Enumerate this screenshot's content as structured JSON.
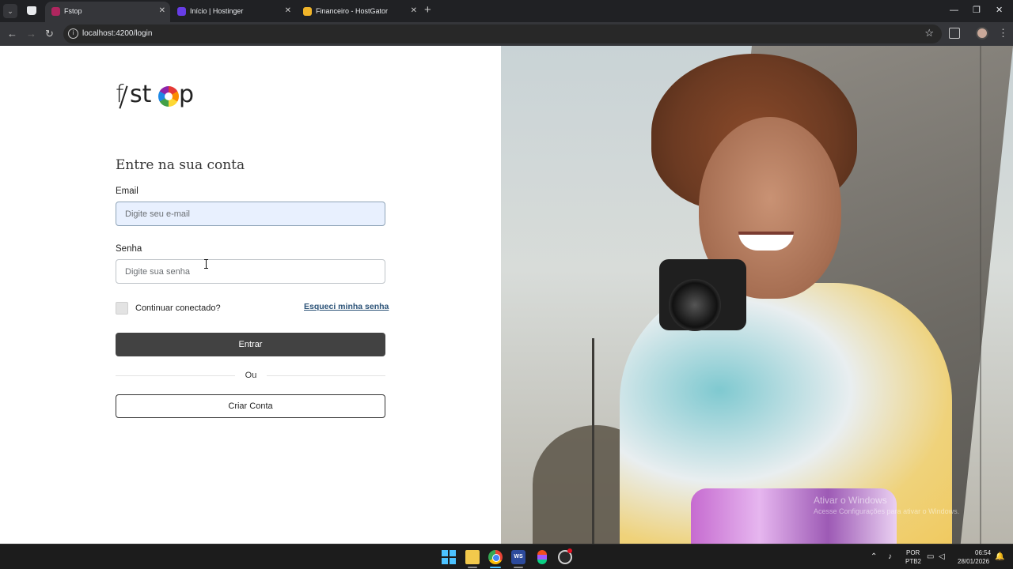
{
  "browser": {
    "tabs": [
      {
        "title": "Fstop",
        "active": true,
        "favicon_color": "#b0265f"
      },
      {
        "title": "Início | Hostinger",
        "active": false,
        "favicon_color": "#673de6"
      },
      {
        "title": "Financeiro - HostGator",
        "active": false,
        "favicon_color": "#f0b429"
      }
    ],
    "url": "localhost:4200/login"
  },
  "page": {
    "logo_text": "f/stop",
    "heading": "Entre na sua conta",
    "email": {
      "label": "Email",
      "placeholder": "Digite seu e-mail",
      "value": ""
    },
    "password": {
      "label": "Senha",
      "placeholder": "Digite sua senha",
      "value": ""
    },
    "remember_label": "Continuar conectado?",
    "remember_checked": false,
    "forgot_link": "Esqueci minha senha",
    "login_button": "Entrar",
    "divider_text": "Ou",
    "create_button": "Criar Conta"
  },
  "hero": {
    "watermark_title": "Ativar o Windows",
    "watermark_text": "Acesse Configurações para ativar o Windows."
  },
  "taskbar": {
    "lang_top": "POR",
    "lang_bottom": "PTB2",
    "time": "06:54",
    "date": "28/01/2026"
  },
  "colors": {
    "primary_button": "#424242",
    "link": "#2b5277",
    "email_fill": "#e8f0fe"
  }
}
